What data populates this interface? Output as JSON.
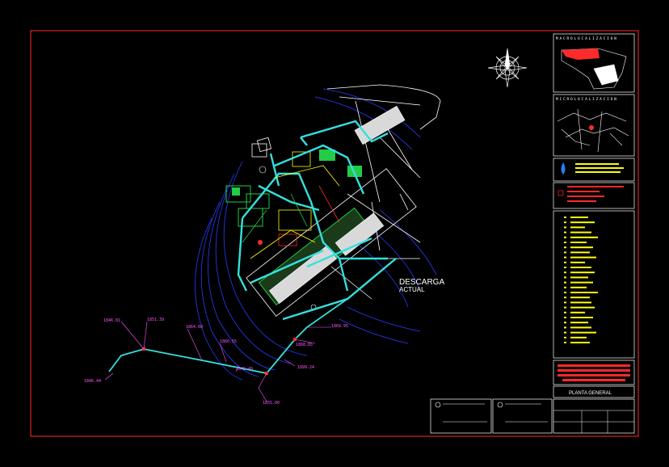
{
  "drawing": {
    "annotation_main": "DESCARGA",
    "annotation_sub": "ACTUAL",
    "elevations": [
      "1846.81",
      "1851.39",
      "1864.60",
      "1860.55",
      "1869.95",
      "1868.85",
      "1846.44",
      "1855.00",
      "1899.24",
      "1846.49"
    ]
  },
  "titleblock": {
    "macro_header": "MACROLOCALIZACION",
    "micro_header": "MICROLOCALIZACION",
    "sheet_title": "PLANTA GENERAL"
  },
  "colors": {
    "frame": "#ff2a2a",
    "water": "#33e0e0",
    "contour": "#2a3cff",
    "highlight": "#ffff00",
    "elev_label": "#ff55ff",
    "green": "#22cc44",
    "white": "#ffffff"
  }
}
